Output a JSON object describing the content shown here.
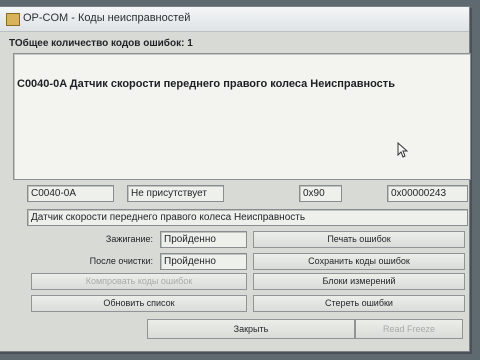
{
  "window": {
    "title": "OP-COM - Коды неисправностей"
  },
  "summary": {
    "count_label": "ТОбщее количество кодов ошибок: 1"
  },
  "fault_list": {
    "items": [
      "C0040-0A Датчик скорости переднего правого колеса Неисправность"
    ]
  },
  "fault_detail": {
    "code": "C0040-0A",
    "status": "Не присутствует",
    "hex_short": "0x90",
    "hex_long": "0x00000243",
    "description": "Датчик скорости переднего правого колеса Неисправность"
  },
  "conditions": {
    "ignition_label": "Зажигание:",
    "ignition_value": "Пройденно",
    "after_clear_label": "После очистки:",
    "after_clear_value": "Пройденно"
  },
  "buttons": {
    "print_errors": "Печать ошибок",
    "save_codes": "Сохранить коды ошибок",
    "compare_codes": "Компровать коды ошибок",
    "measurement_blocks": "Блоки измерений",
    "refresh_list": "Обновить список",
    "erase_errors": "Стереть ошибки",
    "close": "Закрыть",
    "read_freeze": "Read Freeze"
  },
  "icons": {
    "app": "op-com-icon",
    "cursor": "mouse-cursor-icon"
  }
}
